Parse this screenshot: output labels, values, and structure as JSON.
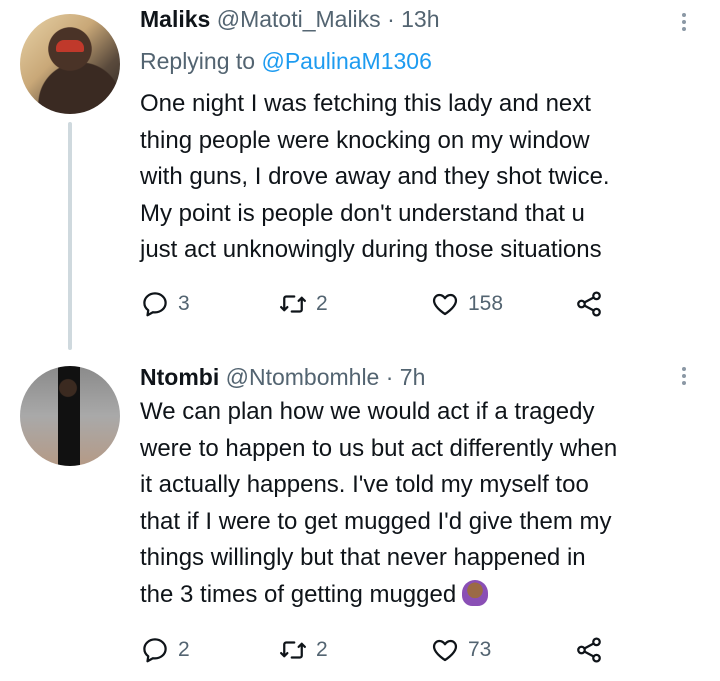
{
  "tweets": [
    {
      "name": "Maliks",
      "handle": "@Matoti_Maliks",
      "separator": "·",
      "time": "13h",
      "replying_prefix": "Replying to",
      "replying_to": "@PaulinaM1306",
      "lines": [
        "One night I was fetching this lady and next",
        "thing people were knocking on my window",
        "with guns, I drove away and they shot twice.",
        "My point is people don't understand that u",
        "just act unknowingly during those situations"
      ],
      "replies": "3",
      "retweets": "2",
      "likes": "158"
    },
    {
      "name": "Ntombi",
      "handle": "@Ntombomhle",
      "separator": "·",
      "time": "7h",
      "lines": [
        "We can plan how we would act if a tragedy",
        "were to happen to us but act differently when",
        "it actually happens. I've told my myself too",
        "that if I were to get mugged I'd give them my",
        "things willingly but that never happened in",
        "the 3 times of getting mugged"
      ],
      "trailing_emoji": "person-facepalming-emoji",
      "replies": "2",
      "retweets": "2",
      "likes": "73"
    }
  ],
  "icons": {
    "reply": "reply-icon",
    "retweet": "retweet-icon",
    "like": "heart-icon",
    "share": "share-icon",
    "more": "more-options-icon"
  },
  "colors": {
    "text": "#0f1419",
    "secondary": "#536471",
    "link": "#1d9bf0",
    "thread_line": "#cfd9de"
  }
}
